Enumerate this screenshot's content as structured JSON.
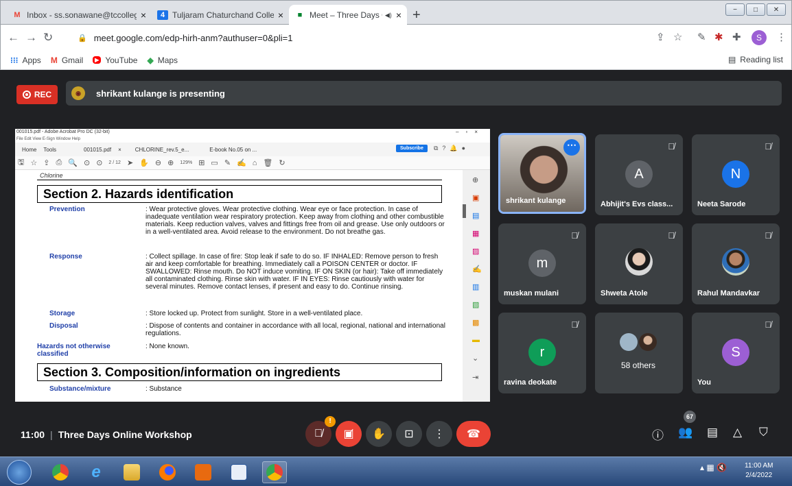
{
  "browser": {
    "tabs": [
      {
        "title": "Inbox - ss.sonawane@tccollege.c",
        "icon": "gmail-icon",
        "close": "×"
      },
      {
        "title": "Tuljaram Chaturchand College of",
        "icon": "calendar-icon",
        "close": "×"
      },
      {
        "title": "Meet – Three Days Online W",
        "icon": "meet-icon",
        "close": "×",
        "audio": "◀)"
      }
    ],
    "new_tab": "+",
    "url": "meet.google.com/edp-hirh-anm?authuser=0&pli=1",
    "profile_initial": "S",
    "bookmarks": [
      {
        "label": "Apps",
        "icon": "apps-grid-icon"
      },
      {
        "label": "Gmail",
        "icon": "gmail-icon"
      },
      {
        "label": "YouTube",
        "icon": "youtube-icon"
      },
      {
        "label": "Maps",
        "icon": "maps-icon"
      }
    ],
    "reading_list": "Reading list"
  },
  "meet": {
    "rec_label": "REC",
    "presenting_text": "shrikant kulange is presenting",
    "time": "11:00",
    "separator": "|",
    "meeting_title": "Three Days Online Workshop",
    "participant_count": "67",
    "mic_warning": "!",
    "participants": [
      {
        "name": "shrikant kulange",
        "type": "video"
      },
      {
        "name": "Abhijit's Evs class...",
        "initial": "A",
        "color": "#5f6368"
      },
      {
        "name": "Neeta Sarode",
        "initial": "N",
        "color": "#1a73e8"
      },
      {
        "name": "muskan mulani",
        "initial": "m",
        "color": "#5f6368"
      },
      {
        "name": "Shweta Atole",
        "type": "photo"
      },
      {
        "name": "Rahul Mandavkar",
        "type": "photo"
      },
      {
        "name": "ravina deokate",
        "initial": "r",
        "color": "#0f9d58"
      },
      {
        "name": "58 others",
        "type": "group"
      },
      {
        "name": "You",
        "initial": "S",
        "color": "#9c5fd4"
      }
    ]
  },
  "pdf": {
    "window_title": "001015.pdf - Adobe Acrobat Pro DC (32-bit)",
    "menu": "File  Edit  View  E-Sign  Window  Help",
    "tabs": [
      "Home",
      "Tools",
      "001015.pdf",
      "×",
      "CHLORINE_rev.5_e...",
      "E-book No.05 on ..."
    ],
    "subscribe": "Subscribe",
    "page_indicator": "2 / 12",
    "zoom": "129%",
    "header_chem": "Chlorine",
    "section2_title": "Section 2. Hazards identification",
    "rows": [
      {
        "label": "Prevention",
        "text": ": Wear protective gloves. Wear protective clothing. Wear eye or face protection.  In case of inadequate ventilation wear respiratory protection.  Keep away from clothing and other combustible materials.  Keep reduction valves, valves and fittings free from oil and grease.  Use only outdoors or in a well-ventilated area.  Avoid release to the environment.  Do not breathe gas."
      },
      {
        "label": "Response",
        "text": ": Collect spillage.  In case of fire: Stop leak if safe to do so.  IF INHALED: Remove person to fresh air and keep comfortable for breathing.  Immediately call a POISON CENTER or doctor.  IF SWALLOWED: Rinse mouth. Do NOT induce vomiting.  IF ON SKIN (or hair): Take off immediately all contaminated clothing. Rinse skin with water.  IF IN EYES: Rinse cautiously with water for several minutes. Remove contact lenses, if present and easy to do. Continue rinsing."
      },
      {
        "label": "Storage",
        "text": ": Store locked up.  Protect from sunlight. Store in a well-ventilated place."
      },
      {
        "label": "Disposal",
        "text": ": Dispose of contents and container in accordance with all local, regional, national and international regulations."
      },
      {
        "label": "Hazards not otherwise classified",
        "text": ": None known."
      }
    ],
    "section3_title": "Section 3. Composition/information on ingredients",
    "row_partial": {
      "label": "Substance/mixture",
      "text": ": Substance"
    }
  },
  "taskbar": {
    "time": "11:00 AM",
    "date": "2/4/2022"
  }
}
